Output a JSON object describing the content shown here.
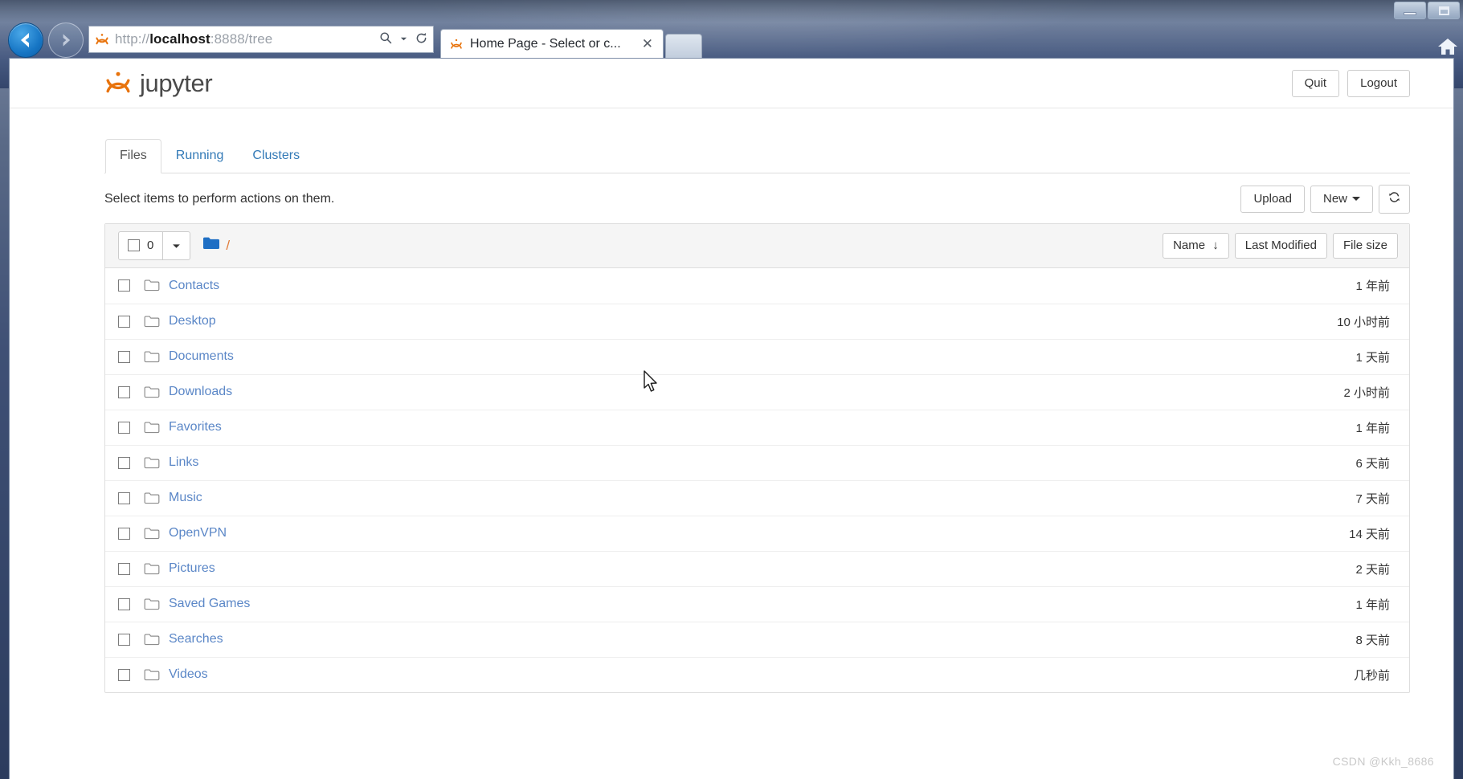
{
  "browser": {
    "address_value": "http://localhost:8888/tree",
    "address_host": "localhost",
    "address_prefix": "http://",
    "address_suffix": ":8888/tree",
    "back_icon": "back-arrow-icon",
    "forward_icon": "forward-arrow-icon",
    "search_icon": "magnifier-icon",
    "refresh_icon": "refresh-icon",
    "home_icon": "home-icon",
    "tab": {
      "title": "Home Page - Select or c...",
      "close_label": "✕",
      "favicon": "jupyter-favicon"
    },
    "new_tab_label": "",
    "window_controls": {
      "minimize": "minimize-button",
      "maximize": "maximize-button"
    }
  },
  "header": {
    "logo_text": "jupyter",
    "quit_label": "Quit",
    "logout_label": "Logout"
  },
  "tabs": [
    {
      "label": "Files",
      "active": true
    },
    {
      "label": "Running",
      "active": false
    },
    {
      "label": "Clusters",
      "active": false
    }
  ],
  "toolbar": {
    "message": "Select items to perform actions on them.",
    "upload_label": "Upload",
    "new_label": "New",
    "refresh_icon": "refresh-icon",
    "refresh_title": "Refresh notebook list"
  },
  "list_header": {
    "selected_count": "0",
    "select_all_checkbox": "unchecked",
    "dropdown_caret": "chevron-down-icon",
    "breadcrumb_root": "/",
    "folder_icon": "folder-icon",
    "sort_name": "Name",
    "sort_name_arrow": "↓",
    "sort_last_modified": "Last Modified",
    "sort_file_size": "File size"
  },
  "files": [
    {
      "name": "Contacts",
      "modified": "1 年前",
      "icon": "folder-icon",
      "checked": false
    },
    {
      "name": "Desktop",
      "modified": "10 小时前",
      "icon": "folder-icon",
      "checked": false
    },
    {
      "name": "Documents",
      "modified": "1 天前",
      "icon": "folder-icon",
      "checked": false
    },
    {
      "name": "Downloads",
      "modified": "2 小时前",
      "icon": "folder-icon",
      "checked": false
    },
    {
      "name": "Favorites",
      "modified": "1 年前",
      "icon": "folder-icon",
      "checked": false
    },
    {
      "name": "Links",
      "modified": "6 天前",
      "icon": "folder-icon",
      "checked": false
    },
    {
      "name": "Music",
      "modified": "7 天前",
      "icon": "folder-icon",
      "checked": false
    },
    {
      "name": "OpenVPN",
      "modified": "14 天前",
      "icon": "folder-icon",
      "checked": false
    },
    {
      "name": "Pictures",
      "modified": "2 天前",
      "icon": "folder-icon",
      "checked": false
    },
    {
      "name": "Saved Games",
      "modified": "1 年前",
      "icon": "folder-icon",
      "checked": false
    },
    {
      "name": "Searches",
      "modified": "8 天前",
      "icon": "folder-icon",
      "checked": false
    },
    {
      "name": "Videos",
      "modified": "几秒前",
      "icon": "folder-icon",
      "checked": false
    }
  ],
  "watermark": "CSDN @Kkh_8686",
  "colors": {
    "jupyter_orange": "#e8730c",
    "link_blue": "#5b87c7",
    "tab_link_blue": "#337ab7",
    "folder_blue": "#1f6fc4",
    "border_gray": "#dddddd",
    "header_bg": "#f5f5f5"
  }
}
